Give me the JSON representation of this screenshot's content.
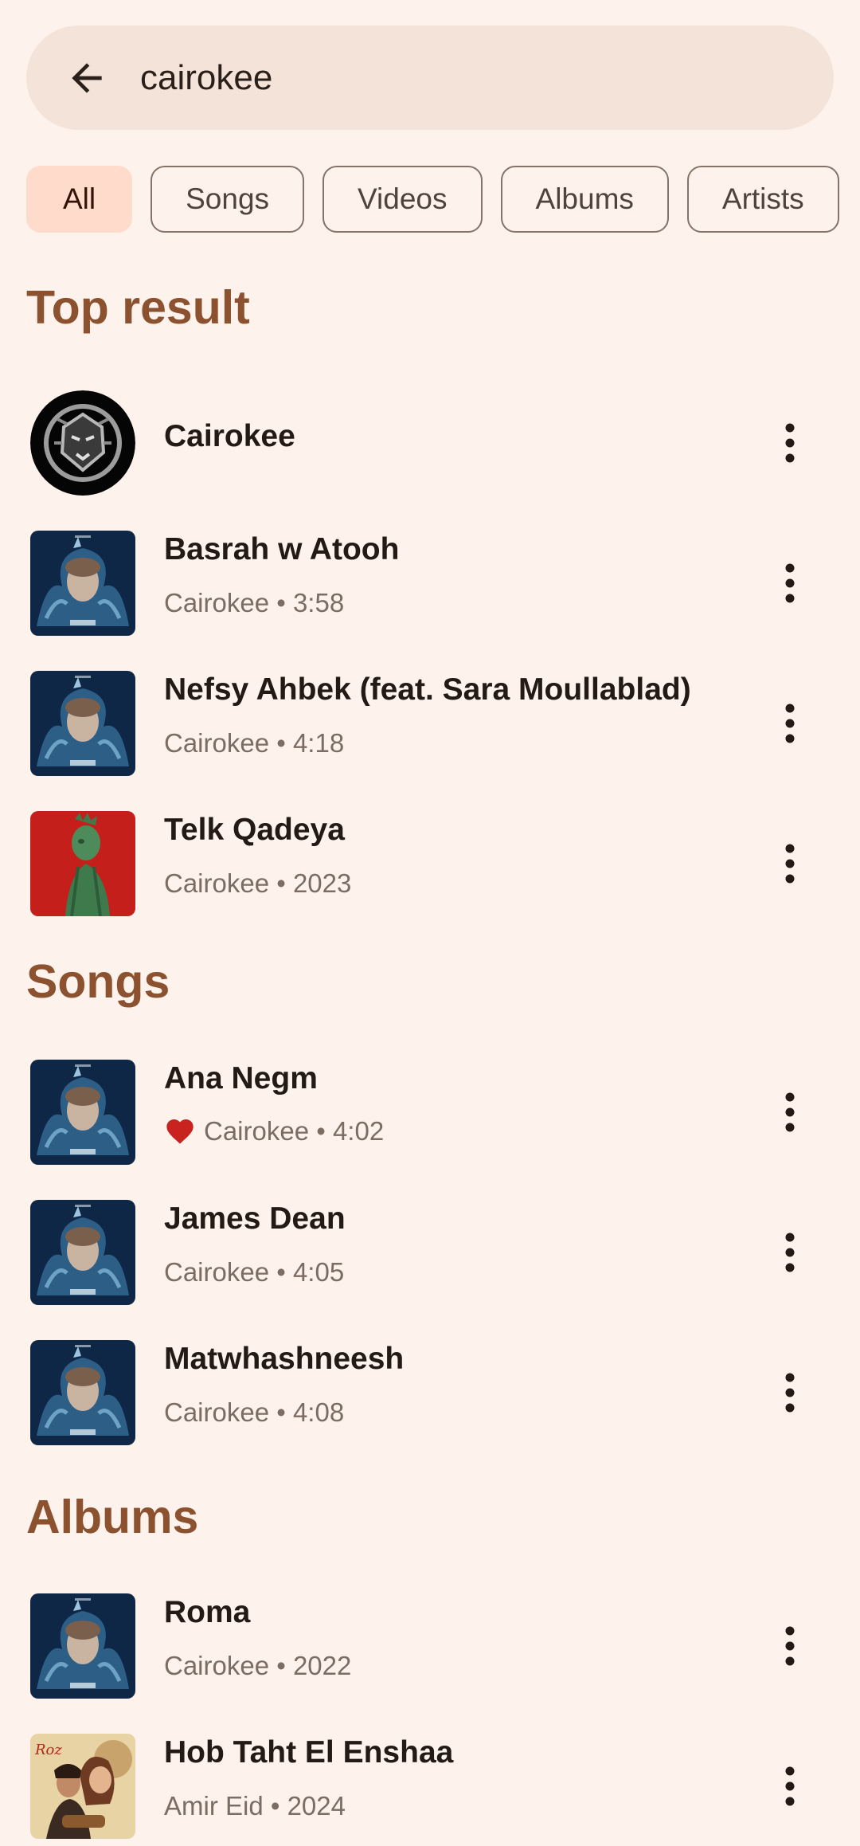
{
  "search": {
    "query": "cairokee"
  },
  "filters": [
    "All",
    "Songs",
    "Videos",
    "Albums",
    "Artists"
  ],
  "sections": {
    "top_result": "Top result",
    "songs": "Songs",
    "albums": "Albums"
  },
  "top_results": [
    {
      "title": "Cairokee",
      "subtitle": "",
      "art": "artist-lion-logo"
    },
    {
      "title": "Basrah w Atooh",
      "subtitle": "Cairokee • 3:58",
      "art": "roma-cover"
    },
    {
      "title": "Nefsy Ahbek (feat. Sara Moullablad)",
      "subtitle": "Cairokee • 4:18",
      "art": "roma-cover"
    },
    {
      "title": "Telk Qadeya",
      "subtitle": "Cairokee • 2023",
      "art": "statue-red-cover"
    }
  ],
  "songs": [
    {
      "title": "Ana Negm",
      "subtitle": "Cairokee • 4:02",
      "liked": true,
      "art": "roma-cover"
    },
    {
      "title": "James Dean",
      "subtitle": "Cairokee • 4:05",
      "liked": false,
      "art": "roma-cover"
    },
    {
      "title": "Matwhashneesh",
      "subtitle": "Cairokee • 4:08",
      "liked": false,
      "art": "roma-cover"
    }
  ],
  "albums": [
    {
      "title": "Roma",
      "subtitle": "Cairokee • 2022",
      "art": "roma-cover"
    },
    {
      "title": "Hob Taht El Enshaa",
      "subtitle": "Amir Eid • 2024",
      "art": "vintage-poster-cover"
    }
  ],
  "colors": {
    "background": "#fdf3ec",
    "search_bar": "#f3e3d8",
    "selected_chip": "#ffdbcb",
    "section_title": "#8c5230",
    "heart": "#c8231f"
  }
}
